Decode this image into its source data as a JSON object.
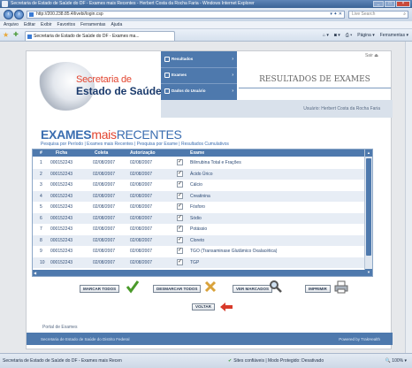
{
  "window": {
    "title": "Secretaria de Estado de Saúde do DF - Exames mais Recentes - Herbert Costa da Rocha Faria - Windows Internet Explorer"
  },
  "address_bar": {
    "url": "http://200.238.85.4/livebi/login.csp",
    "search_placeholder": "Live Search"
  },
  "menu": [
    "Arquivo",
    "Editar",
    "Exibir",
    "Favoritos",
    "Ferramentas",
    "Ajuda"
  ],
  "tab": {
    "label": "Secretaria de Estado de Saúde do DF - Exames ma..."
  },
  "toolbar_right": {
    "page_label": "Página",
    "tools_label": "Ferramentas"
  },
  "header": {
    "logo_line1": "Secretaria de",
    "logo_line2": "Estado de Saúde",
    "nav": [
      {
        "label": "Resultados"
      },
      {
        "label": "Exames"
      },
      {
        "label": "Dados do Usuário"
      }
    ],
    "section_title": "RESULTADOS DE EXAMES",
    "logout": "Sair",
    "user": "Usuário: Herbert Costa da Rocha Faria"
  },
  "main": {
    "title_part1": "EXAMES",
    "title_part2": "mais",
    "title_part3": "RECENTES",
    "links": "Pesquisa por Período  |  Exames mais Recentes  |  Pesquisa por Exame  |  Resultados Cumulativos"
  },
  "table": {
    "headers": {
      "num": "#",
      "ficha": "Ficha",
      "coleta": "Coleta",
      "autorizacao": "Autorização",
      "exame": "Exame"
    },
    "rows": [
      {
        "num": "1",
        "ficha": "000152243",
        "coleta": "02/08/2007",
        "autorizacao": "02/08/2007",
        "checked": true,
        "exame": "Bilirrubina Total e Frações"
      },
      {
        "num": "2",
        "ficha": "000152243",
        "coleta": "02/08/2007",
        "autorizacao": "02/08/2007",
        "checked": true,
        "exame": "Ácido Úrico"
      },
      {
        "num": "3",
        "ficha": "000152243",
        "coleta": "02/08/2007",
        "autorizacao": "02/08/2007",
        "checked": true,
        "exame": "Cálcio"
      },
      {
        "num": "4",
        "ficha": "000152243",
        "coleta": "02/08/2007",
        "autorizacao": "02/08/2007",
        "checked": true,
        "exame": "Creatinina"
      },
      {
        "num": "5",
        "ficha": "000152243",
        "coleta": "02/08/2007",
        "autorizacao": "02/08/2007",
        "checked": true,
        "exame": "Fósforo"
      },
      {
        "num": "6",
        "ficha": "000152243",
        "coleta": "02/08/2007",
        "autorizacao": "02/08/2007",
        "checked": true,
        "exame": "Sódio"
      },
      {
        "num": "7",
        "ficha": "000152243",
        "coleta": "02/08/2007",
        "autorizacao": "02/08/2007",
        "checked": true,
        "exame": "Potássio"
      },
      {
        "num": "8",
        "ficha": "000152243",
        "coleta": "02/08/2007",
        "autorizacao": "02/08/2007",
        "checked": true,
        "exame": "Cloreto"
      },
      {
        "num": "9",
        "ficha": "000152243",
        "coleta": "02/08/2007",
        "autorizacao": "02/08/2007",
        "checked": true,
        "exame": "TGO (Transaminase Glutâmico Oxalacética)"
      },
      {
        "num": "10",
        "ficha": "000152243",
        "coleta": "02/08/2007",
        "autorizacao": "02/08/2007",
        "checked": true,
        "exame": "TGP"
      }
    ]
  },
  "actions": {
    "select_all": "MARCAR TODOS",
    "unselect_all": "DESMARCAR TODOS",
    "view_selected": "VER MARCADOS",
    "print": "IMPRIMIR",
    "back": "VOLTAR"
  },
  "portal": "Portal de Exames",
  "footer": {
    "left": "Secretaria de Estado de Saúde do Distrito Federal",
    "right": "Powered by TrakHealth"
  },
  "statusbar": {
    "left": "Secretaria de Estado de Saúde do DF - Exames mais Recen",
    "middle": "Sites confiáveis | Modo Protegido: Desativado",
    "zoom": "100%"
  },
  "colors": {
    "accent_blue": "#4e79ad",
    "brand_red": "#e2442f",
    "title_blue": "#3a6db0"
  }
}
